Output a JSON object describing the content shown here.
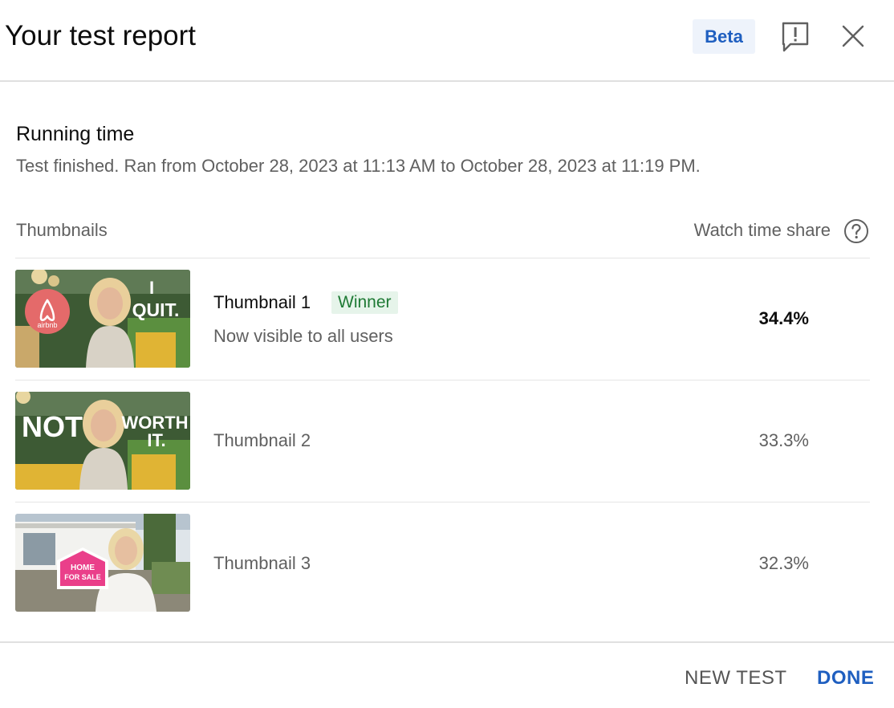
{
  "header": {
    "title": "Your test report",
    "badge": "Beta"
  },
  "running_time": {
    "title": "Running time",
    "description": "Test finished. Ran from October 28, 2023 at 11:13 AM to October 28, 2023 at 11:19 PM."
  },
  "table": {
    "col_thumbnails": "Thumbnails",
    "col_watch_share": "Watch time share",
    "rows": [
      {
        "name": "Thumbnail 1",
        "badge": "Winner",
        "subtitle": "Now visible to all users",
        "share": "34.4%",
        "thumb_text_1": "I",
        "thumb_text_2": "QUIT.",
        "thumb_logo": "airbnb"
      },
      {
        "name": "Thumbnail 2",
        "share": "33.3%",
        "thumb_text_1": "NOT",
        "thumb_text_2": "WORTH",
        "thumb_text_3": "IT."
      },
      {
        "name": "Thumbnail 3",
        "share": "32.3%",
        "thumb_text_1": "HOME",
        "thumb_text_2": "FOR SALE"
      }
    ]
  },
  "footer": {
    "new_test_label": "NEW TEST",
    "done_label": "DONE"
  },
  "colors": {
    "accent_blue": "#1f5fc0",
    "winner_green": "#1e7a34",
    "winner_bg": "#e6f4ea",
    "beta_bg": "#eef3fb"
  },
  "icons": {
    "feedback": "feedback-exclamation-icon",
    "close": "close-icon",
    "help": "help-circle-icon"
  }
}
